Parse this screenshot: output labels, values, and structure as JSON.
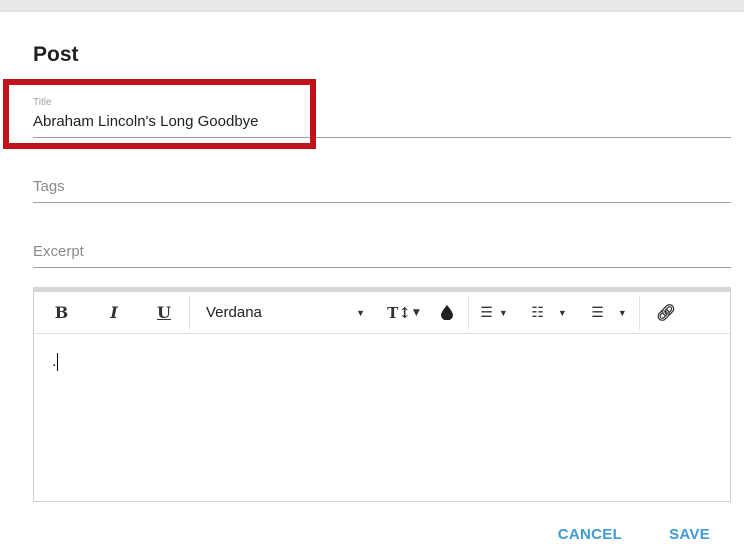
{
  "dialog": {
    "title": "Post"
  },
  "fields": {
    "title": {
      "label": "Title",
      "value": "Abraham Lincoln's Long Goodbye"
    },
    "tags": {
      "placeholder": "Tags"
    },
    "excerpt": {
      "placeholder": "Excerpt"
    }
  },
  "toolbar": {
    "bold": "B",
    "italic": "I",
    "underline": "U",
    "font": "Verdana",
    "font_size_icon": "text-size-icon",
    "color_icon": "ink-drop-icon",
    "align_icon": "align-left-icon",
    "ordered_list_icon": "ordered-list-icon",
    "unordered_list_icon": "unordered-list-icon",
    "link_icon": "link-icon"
  },
  "editor": {
    "content": "."
  },
  "actions": {
    "cancel": "CANCEL",
    "save": "SAVE"
  },
  "colors": {
    "accent": "#3f9ad6",
    "highlight": "#c1121c"
  }
}
